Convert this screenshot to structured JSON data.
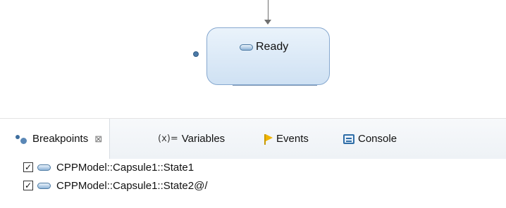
{
  "diagram": {
    "state": {
      "name": "Ready",
      "icon": "state-pill-icon"
    }
  },
  "view": {
    "tabs": [
      {
        "label": "Breakpoints",
        "icon": "breakpoints-icon",
        "active": true,
        "closable": true
      },
      {
        "label": "Variables",
        "icon_text": "(x)=",
        "icon": "variables-icon",
        "active": false
      },
      {
        "label": "Events",
        "icon": "events-flag-icon",
        "active": false
      },
      {
        "label": "Console",
        "icon": "console-icon",
        "active": false
      }
    ],
    "close_glyph": "⊠",
    "checkbox_glyph": "✓",
    "breakpoints": [
      {
        "label": "CPPModel::Capsule1::State1",
        "checked": true
      },
      {
        "label": "CPPModel::Capsule1::State2@/",
        "checked": true
      }
    ]
  },
  "colors": {
    "state_fill_top": "#eaf3fb",
    "state_fill_bottom": "#cfe1f3",
    "state_border": "#86a8cf",
    "tab_bar": "#eef2f6",
    "accent_blue": "#2f6ea7"
  }
}
